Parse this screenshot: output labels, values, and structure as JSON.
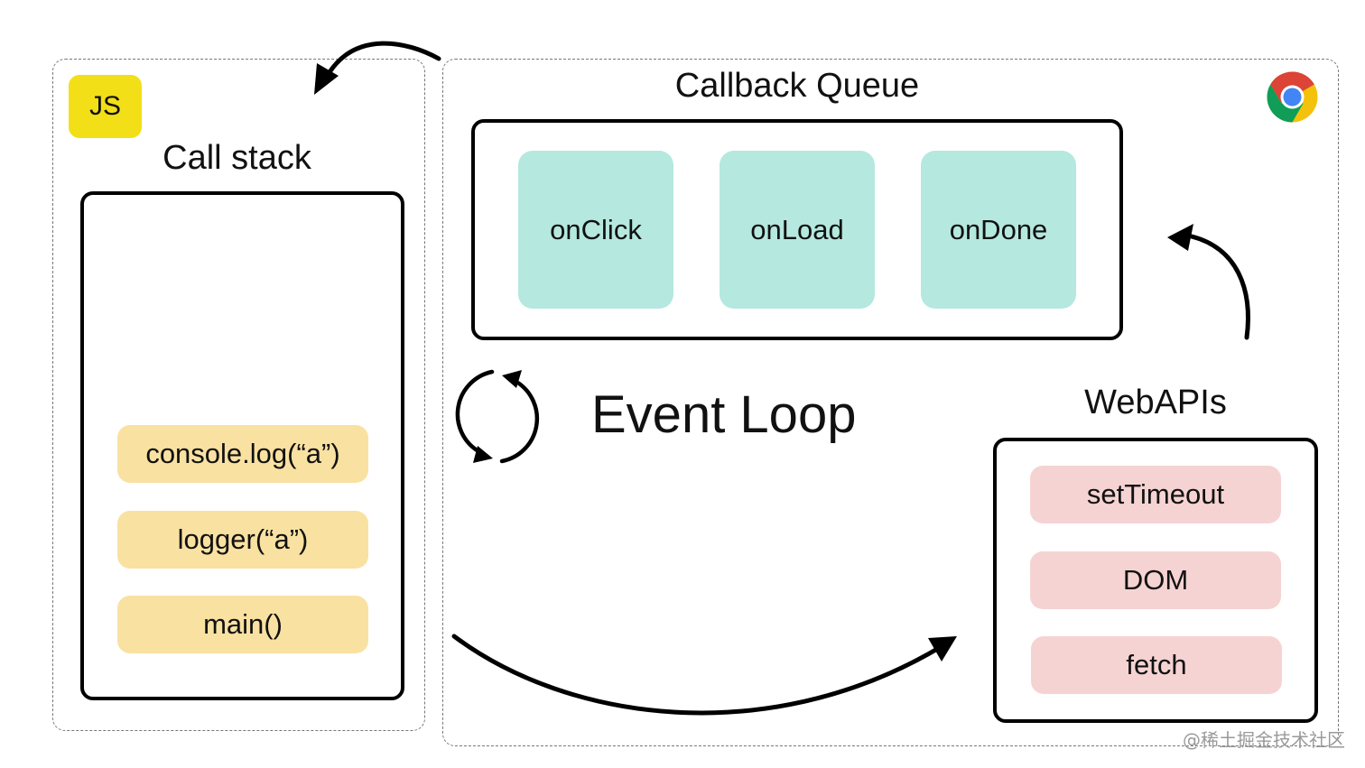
{
  "js_engine": {
    "badge_label": "JS",
    "title": "Call stack",
    "frames": [
      {
        "label": "console.log(“a”)"
      },
      {
        "label": "logger(“a”)"
      },
      {
        "label": "main()"
      }
    ]
  },
  "browser": {
    "icon": "chrome-icon",
    "callback_queue": {
      "title": "Callback Queue",
      "callbacks": [
        {
          "label": "onClick"
        },
        {
          "label": "onLoad"
        },
        {
          "label": "onDone"
        }
      ]
    },
    "event_loop": {
      "title": "Event Loop",
      "icon": "loop-arrows-icon"
    },
    "web_apis": {
      "title": "WebAPIs",
      "items": [
        {
          "label": "setTimeout"
        },
        {
          "label": "DOM"
        },
        {
          "label": "fetch"
        }
      ]
    }
  },
  "colors": {
    "js_badge": "#f3df17",
    "stack_frame": "#f9e1a1",
    "callback": "#b5e8df",
    "web_api": "#f6d3d3",
    "chrome_red": "#db4437",
    "chrome_green": "#0f9d58",
    "chrome_yellow": "#f4c20d",
    "chrome_blue": "#4285f4"
  },
  "watermark": "@稀土掘金技术社区"
}
